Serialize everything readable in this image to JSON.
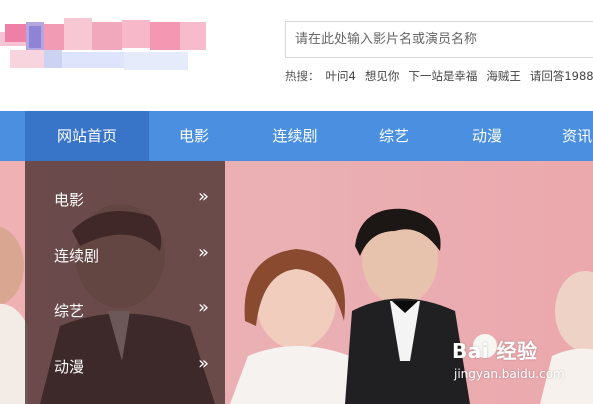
{
  "search": {
    "placeholder": "请在此处输入影片名或演员名称"
  },
  "hot": {
    "label": "热搜：",
    "items": [
      "叶问4",
      "想见你",
      "下一站是幸福",
      "海贼王",
      "请回答1988"
    ]
  },
  "nav": {
    "items": [
      "网站首页",
      "电影",
      "连续剧",
      "综艺",
      "动漫",
      "资讯"
    ],
    "active_index": 0
  },
  "dropdown": {
    "items": [
      {
        "label": "电影",
        "icon": "double-chevron-right-icon",
        "chevron": "»"
      },
      {
        "label": "连续剧",
        "icon": "double-chevron-right-icon",
        "chevron": "»"
      },
      {
        "label": "综艺",
        "icon": "double-chevron-right-icon",
        "chevron": "»"
      },
      {
        "label": "动漫",
        "icon": "double-chevron-right-icon",
        "chevron": "»"
      }
    ]
  },
  "watermark": {
    "brand": "Bai 经验",
    "sub": "jingyan.baidu.com"
  },
  "colors": {
    "nav_bg": "#4a8fe0",
    "nav_active": "#3874c8",
    "banner_bg": "#efb1b4",
    "dropdown_bg": "#462d2d"
  }
}
